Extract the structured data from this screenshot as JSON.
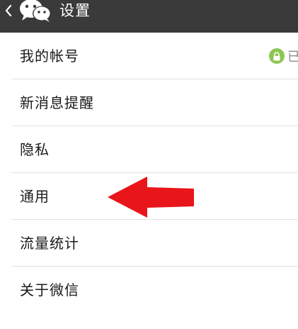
{
  "header": {
    "title": "设置"
  },
  "settings": {
    "items": [
      {
        "label": "我的帐号",
        "status": "已"
      },
      {
        "label": "新消息提醒"
      },
      {
        "label": "隐私"
      },
      {
        "label": "通用"
      },
      {
        "label": "流量统计"
      },
      {
        "label": "关于微信"
      }
    ]
  },
  "colors": {
    "header_bg": "#3a3a3a",
    "lock_badge": "#8cc654",
    "annotation_arrow": "#e8151b"
  },
  "icons": {
    "back": "chevron-left-icon",
    "logo": "wechat-logo-icon",
    "lock": "lock-icon",
    "annotation": "red-arrow-pointer-icon"
  }
}
